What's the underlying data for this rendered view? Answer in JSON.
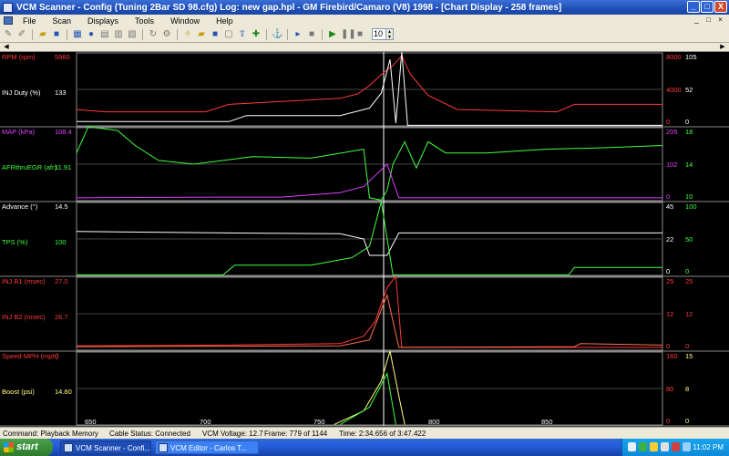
{
  "window": {
    "title": "VCM Scanner  -  Config  (Tuning 2Bar SD 98.cfg)   Log:  new gap.hpl   -  GM Firebird/Camaro (V8) 1998  -  [Chart Display  -  258 frames]",
    "controls": [
      "_",
      "□",
      "X"
    ]
  },
  "menubar": {
    "items": [
      "File",
      "Scan",
      "Displays",
      "Tools",
      "Window",
      "Help"
    ],
    "mdi_controls": [
      "_",
      "□",
      "×"
    ]
  },
  "toolbar": {
    "frame_step_value": "10"
  },
  "chart_panels": [
    {
      "name": "rpm-injduty",
      "left_labels": [
        {
          "label": "RPM (rpm)",
          "value": "5960",
          "color": "#ff3a3a"
        },
        {
          "label": "INJ Duty (%)",
          "value": "133",
          "color": "#ffffff"
        }
      ],
      "right_axis_1": {
        "labels": [
          "8000",
          "4000",
          "0"
        ],
        "color": "#ff3a3a"
      },
      "right_axis_2": {
        "labels": [
          "105",
          "52",
          "0"
        ],
        "color": "#ffffff"
      }
    },
    {
      "name": "map-afr",
      "left_labels": [
        {
          "label": "MAP (kPa)",
          "value": "108.4",
          "color": "#e040ff"
        },
        {
          "label": "AFRthruEGR (afr)",
          "value": "11.91",
          "color": "#40ff40"
        }
      ],
      "right_axis_1": {
        "labels": [
          "205",
          "102",
          "0"
        ],
        "color": "#e040ff"
      },
      "right_axis_2": {
        "labels": [
          "18",
          "14",
          "10"
        ],
        "color": "#40ff40"
      }
    },
    {
      "name": "advance-tps",
      "left_labels": [
        {
          "label": "Advance (°)",
          "value": "14.5",
          "color": "#ffffff"
        },
        {
          "label": "TPS (%)",
          "value": "100",
          "color": "#40ff40"
        }
      ],
      "right_axis_1": {
        "labels": [
          "45",
          "22",
          "0"
        ],
        "color": "#ffffff"
      },
      "right_axis_2": {
        "labels": [
          "100",
          "50",
          "0"
        ],
        "color": "#40ff40"
      }
    },
    {
      "name": "injb1-injb2",
      "left_labels": [
        {
          "label": "INJ B1 (msec)",
          "value": "27.0",
          "color": "#ff3a3a"
        },
        {
          "label": "INJ B2 (msec)",
          "value": "26.7",
          "color": "#ff3a3a"
        }
      ],
      "right_axis_1": {
        "labels": [
          "25",
          "12",
          "0"
        ],
        "color": "#ff3a3a"
      },
      "right_axis_2": {
        "labels": [
          "25",
          "12",
          "0"
        ],
        "color": "#ff3a3a"
      }
    },
    {
      "name": "speed-boost",
      "left_labels": [
        {
          "label": "Speed MPH (mph)",
          "value": "0",
          "color": "#ff3a3a"
        },
        {
          "label": "Boost (psi)",
          "value": "14.80",
          "color": "#ffff80"
        }
      ],
      "right_axis_1": {
        "labels": [
          "160",
          "80",
          "0"
        ],
        "color": "#ff3a3a"
      },
      "right_axis_2": {
        "labels": [
          "15",
          "8",
          "0"
        ],
        "color": "#ffff80"
      }
    }
  ],
  "x_axis": {
    "ticks": [
      "650",
      "700",
      "750",
      "800",
      "850"
    ]
  },
  "statusbar": {
    "command": "Command:  Playback Memory",
    "cable": "Cable Status:  Connected",
    "voltage": "VCM Voltage:  12.7",
    "frame": "Frame:  779 of 1144",
    "time": "Time:  2:34.656 of 3:47.422"
  },
  "taskbar": {
    "start": "start",
    "tasks": [
      {
        "label": "VCM Scanner  -  Confi...",
        "active": true
      },
      {
        "label": "VCM Editor  -  Carlos T...",
        "active": false
      }
    ],
    "clock": "11:02 PM"
  }
}
